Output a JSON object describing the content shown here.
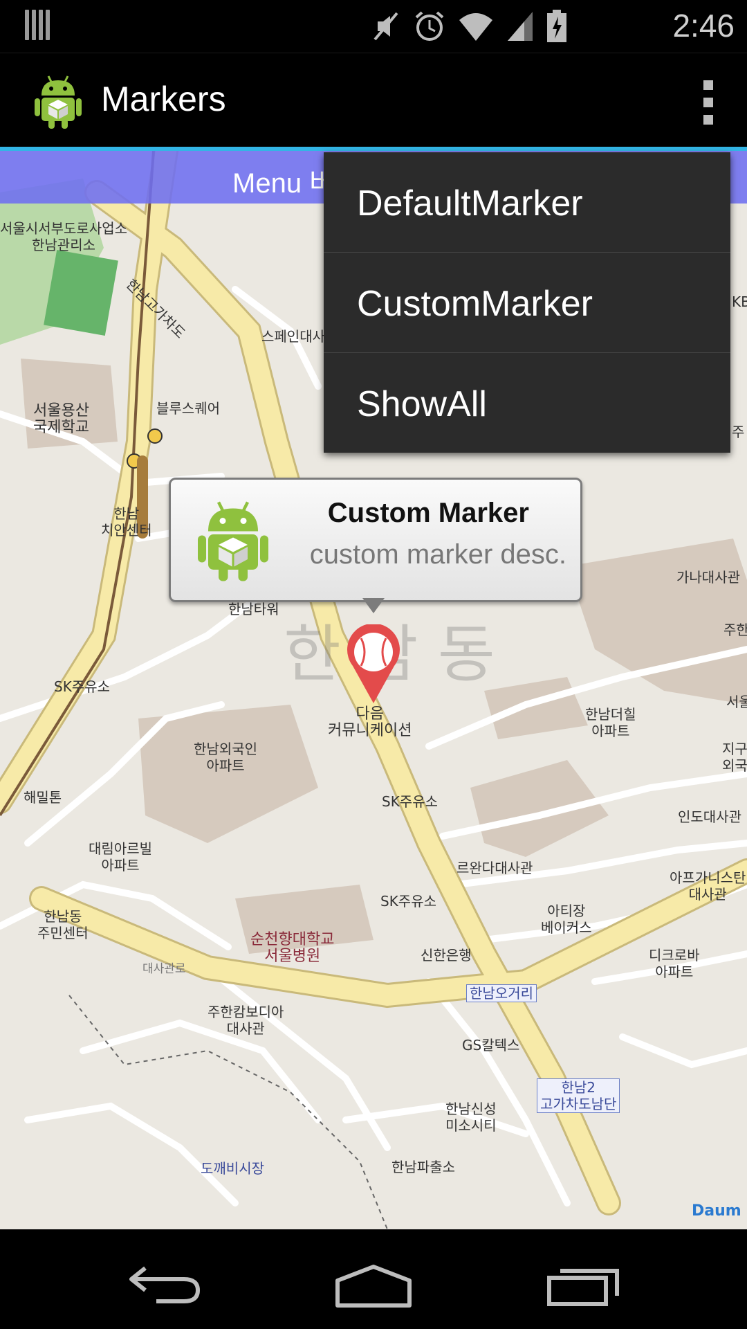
{
  "status_bar": {
    "time": "2:46"
  },
  "action_bar": {
    "title": "Markers"
  },
  "banner": {
    "text": "Menu 버"
  },
  "menu": {
    "items": [
      {
        "label": "DefaultMarker"
      },
      {
        "label": "CustomMarker"
      },
      {
        "label": "ShowAll"
      }
    ]
  },
  "balloon": {
    "title": "Custom Marker",
    "description": "custom marker desc."
  },
  "map": {
    "watermark": "한 남 동",
    "brand": "Daum",
    "labels": [
      "서울시서부도로사업소\n한남관리소",
      "한남고가차도",
      "스페인대사",
      "서울용산\n국제학교",
      "블루스퀘어",
      "한남\n치안센터",
      "가나대사관",
      "한남타워",
      "SK주유소",
      "다음\n커뮤니케이션",
      "한남외국인\n아파트",
      "한남더힐\n아파트",
      "해밀톤",
      "SK주유소",
      "인도대사관",
      "대림아르빌\n아파트",
      "르완다대사관",
      "아프가니스탄\n대사관",
      "SK주유소",
      "아티장\n베이커스",
      "한남동\n주민센터",
      "순천향대학교\n서울병원",
      "신한은행",
      "디크로바\n아파트",
      "대사관로",
      "한남오거리",
      "주한캄보디아\n대사관",
      "GS칼텍스",
      "한남2\n고가차도남단",
      "한남신성\n미소시티",
      "도깨비시장",
      "한남파출소",
      "서울",
      "지구\n외국",
      "주한",
      "KB",
      "주"
    ]
  },
  "colors": {
    "accent": "#33b5e5",
    "banner": "#6e6ef0",
    "menu_bg": "#2b2b2b",
    "map_bg": "#ebe8e1",
    "road_major": "#f7eaa8",
    "marker": "#e34b4b"
  },
  "icons": {
    "status": [
      "notification-icon",
      "mute-icon",
      "alarm-icon",
      "wifi-icon",
      "signal-icon",
      "battery-icon"
    ],
    "nav": [
      "back-icon",
      "home-icon",
      "recents-icon"
    ]
  }
}
